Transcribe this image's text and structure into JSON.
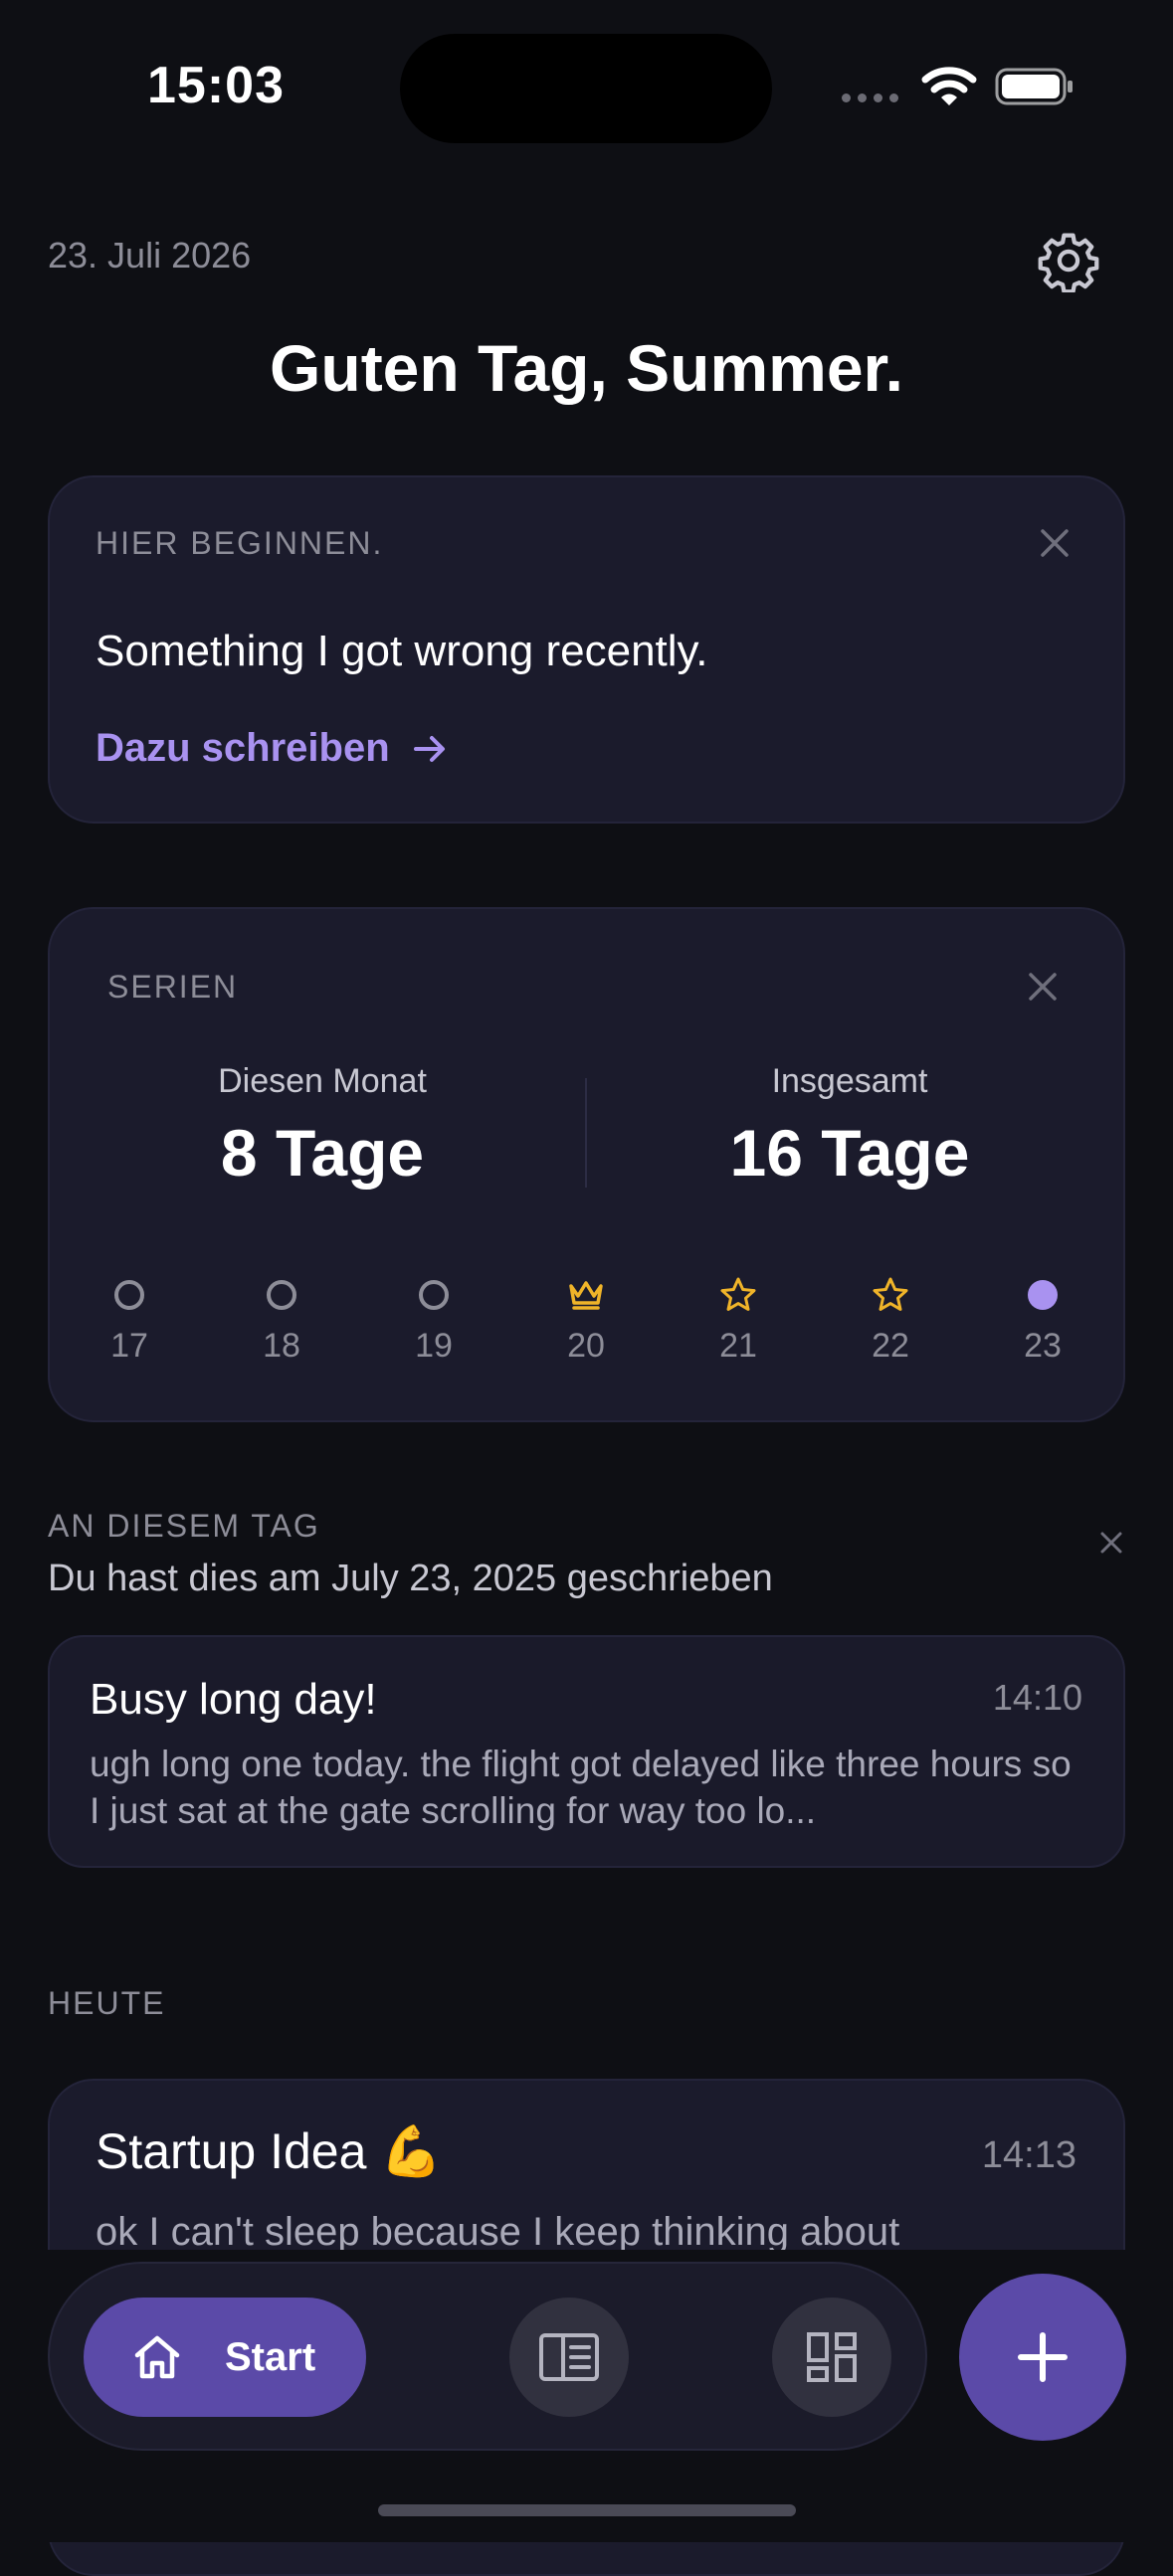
{
  "status_bar": {
    "time": "15:03"
  },
  "header": {
    "date": "23. Juli 2026",
    "greeting": "Guten Tag, Summer."
  },
  "prompt_card": {
    "label": "HIER BEGINNEN.",
    "prompt": "Something I got wrong recently.",
    "link": "Dazu schreiben"
  },
  "streaks": {
    "label": "SERIEN",
    "month": {
      "label": "Diesen Monat",
      "value": "8 Tage"
    },
    "total": {
      "label": "Insgesamt",
      "value": "16 Tage"
    },
    "days": [
      {
        "num": "17",
        "icon": "empty-circle-icon"
      },
      {
        "num": "18",
        "icon": "empty-circle-icon"
      },
      {
        "num": "19",
        "icon": "empty-circle-icon"
      },
      {
        "num": "20",
        "icon": "crown-icon"
      },
      {
        "num": "21",
        "icon": "star-icon"
      },
      {
        "num": "22",
        "icon": "star-icon"
      },
      {
        "num": "23",
        "icon": "filled-circle-icon"
      }
    ]
  },
  "on_this_day": {
    "label": "AN DIESEM TAG",
    "subtitle": "Du hast dies am July 23, 2025 geschrieben",
    "entry": {
      "title": "Busy long day!",
      "time": "14:10",
      "body": "ugh long one today. the flight got delayed like three hours so I just sat at the gate scrolling for way too lo..."
    }
  },
  "today": {
    "label": "HEUTE",
    "entry": {
      "title": "Startup Idea 💪",
      "time": "14:13",
      "body": "ok I can't sleep because I keep thinking about"
    }
  },
  "tabbar": {
    "home_label": "Start"
  },
  "colors": {
    "accent": "#5b4aa8",
    "link": "#a992f0",
    "gold": "#f0b429",
    "background": "#0e0f14",
    "card": "#1b1b2c"
  }
}
